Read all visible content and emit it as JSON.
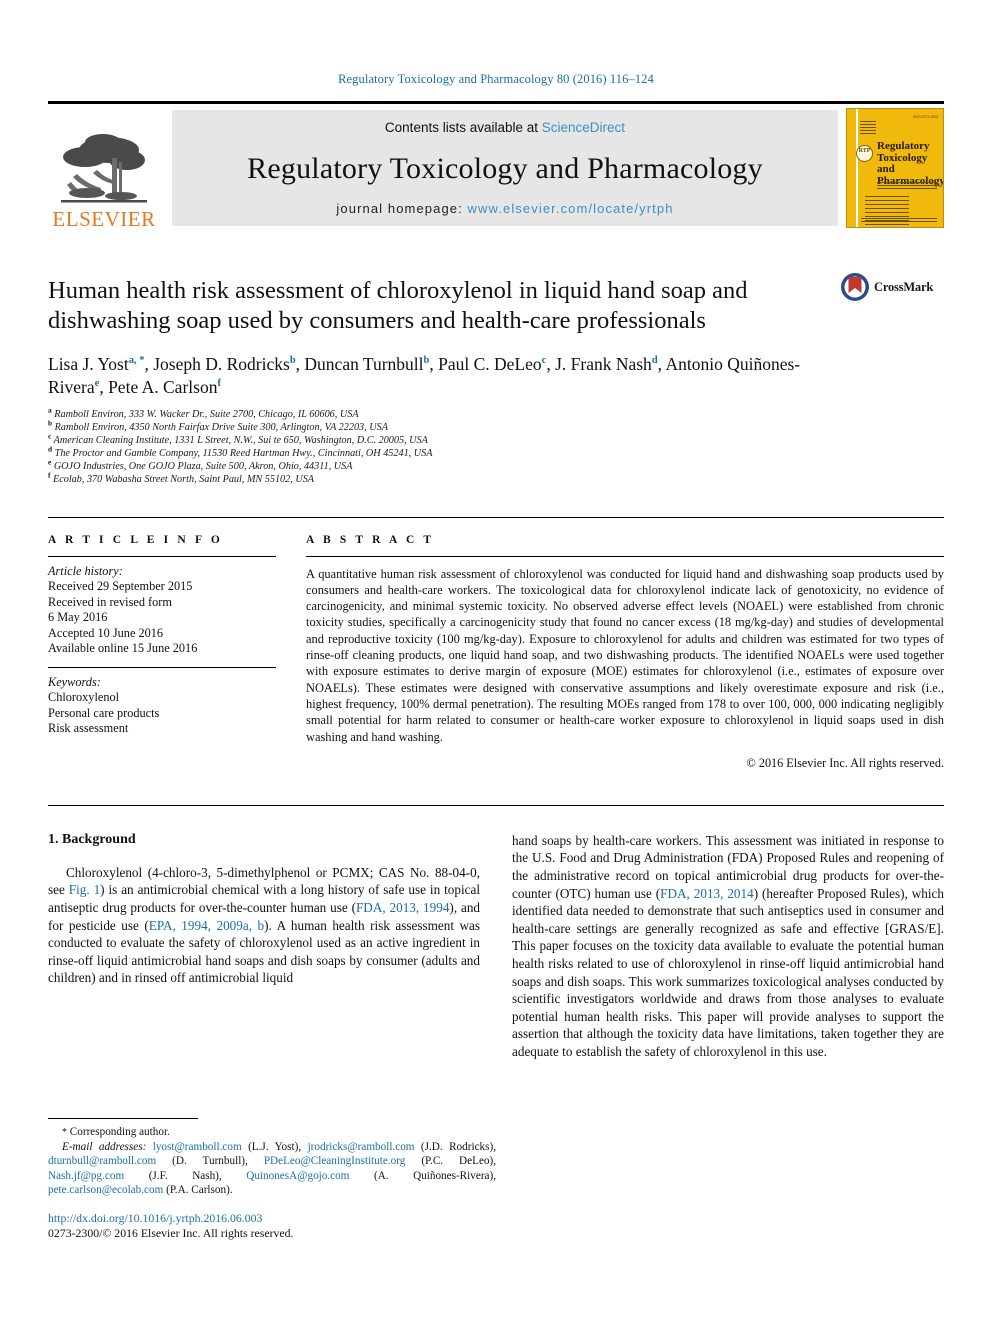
{
  "running_head": "Regulatory Toxicology and Pharmacology 80 (2016) 116–124",
  "colors": {
    "link_blue": "#1a6ea8",
    "sciencedirect_blue": "#3d8fc0",
    "elsevier_orange": "#E87722",
    "cover_yellow": "#f0b90b",
    "crossmark_blue": "#2a4b8d",
    "crossmark_red": "#c0392b"
  },
  "masthead": {
    "publisher_logo_name": "elsevier-tree-logo",
    "publisher_word": "ELSEVIER",
    "contents_prefix": "Contents lists available at",
    "contents_link": "ScienceDirect",
    "journal_title": "Regulatory Toxicology and Pharmacology",
    "homepage_label": "journal homepage:",
    "homepage_url": "www.elsevier.com/locate/yrtph",
    "cover": {
      "title": "Regulatory Toxicology and Pharmacology",
      "badge": "RTP"
    }
  },
  "article": {
    "title": "Human health risk assessment of chloroxylenol in liquid hand soap and dishwashing soap used by consumers and health-care professionals",
    "crossmark_label": "CrossMark",
    "authors": [
      {
        "name": "Lisa J. Yost",
        "marks": "a, *"
      },
      {
        "name": "Joseph D. Rodricks",
        "marks": "b"
      },
      {
        "name": "Duncan Turnbull",
        "marks": "b"
      },
      {
        "name": "Paul C. DeLeo",
        "marks": "c"
      },
      {
        "name": "J. Frank Nash",
        "marks": "d"
      },
      {
        "name": "Antonio Quiñones-Rivera",
        "marks": "e"
      },
      {
        "name": "Pete A. Carlson",
        "marks": "f"
      }
    ],
    "affiliations": [
      {
        "mark": "a",
        "text": "Ramboll Environ, 333 W. Wacker Dr., Suite 2700, Chicago, IL 60606, USA"
      },
      {
        "mark": "b",
        "text": "Ramboll Environ, 4350 North Fairfax Drive Suite 300, Arlington, VA 22203, USA"
      },
      {
        "mark": "c",
        "text": "American Cleaning Institute, 1331 L Street, N.W., Sui te 650, Washington, D.C. 20005, USA"
      },
      {
        "mark": "d",
        "text": "The Proctor and Gamble Company, 11530 Reed Hartman Hwy., Cincinnati, OH 45241, USA"
      },
      {
        "mark": "e",
        "text": "GOJO Industries, One GOJO Plaza, Suite 500, Akron, Ohio, 44311, USA"
      },
      {
        "mark": "f",
        "text": "Ecolab, 370 Wabasha Street North, Saint Paul, MN 55102, USA"
      }
    ]
  },
  "article_info": {
    "heading": "A R T I C L E   I N F O",
    "history_label": "Article history:",
    "history": [
      "Received 29 September 2015",
      "Received in revised form",
      "6 May 2016",
      "Accepted 10 June 2016",
      "Available online 15 June 2016"
    ],
    "keywords_label": "Keywords:",
    "keywords": [
      "Chloroxylenol",
      "Personal care products",
      "Risk assessment"
    ]
  },
  "abstract": {
    "heading": "A B S T R A C T",
    "body": "A quantitative human risk assessment of chloroxylenol was conducted for liquid hand and dishwashing soap products used by consumers and health-care workers. The toxicological data for chloroxylenol indicate lack of genotoxicity, no evidence of carcinogenicity, and minimal systemic toxicity. No observed adverse effect levels (NOAEL) were established from chronic toxicity studies, specifically a carcinogenicity study that found no cancer excess (18 mg/kg-day) and studies of developmental and reproductive toxicity (100 mg/kg-day). Exposure to chloroxylenol for adults and children was estimated for two types of rinse-off cleaning products, one liquid hand soap, and two dishwashing products. The identified NOAELs were used together with exposure estimates to derive margin of exposure (MOE) estimates for chloroxylenol (i.e., estimates of exposure over NOAELs). These estimates were designed with conservative assumptions and likely overestimate exposure and risk (i.e., highest frequency, 100% dermal penetration). The resulting MOEs ranged from 178 to over 100, 000, 000 indicating negligibly small potential for harm related to consumer or health-care worker exposure to chloroxylenol in liquid soaps used in dish washing and hand washing.",
    "copyright": "© 2016 Elsevier Inc. All rights reserved."
  },
  "body": {
    "section_heading": "1. Background",
    "left_para_1": "Chloroxylenol (4-chloro-3, 5-dimethylphenol or PCMX; CAS No. 88-04-0, see ",
    "left_link_fig": "Fig. 1",
    "left_para_2": ") is an antimicrobial chemical with a long history of safe use in topical antiseptic drug products for over-the-counter human use (",
    "left_link_fda": "FDA, 2013, 1994",
    "left_para_3": "), and for pesticide use (",
    "left_link_epa": "EPA, 1994, 2009a, b",
    "left_para_4": "). A human health risk assessment was conducted to evaluate the safety of chloroxylenol used as an active ingredient in rinse-off liquid antimicrobial hand soaps and dish soaps by consumer (adults and children) and in rinsed off antimicrobial liquid",
    "right_para_1": "hand soaps by health-care workers. This assessment was initiated in response to the U.S. Food and Drug Administration (FDA) Proposed Rules and reopening of the administrative record on topical antimicrobial drug products for over-the-counter (OTC) human use (",
    "right_link_fda": "FDA, 2013, 2014",
    "right_para_2": ") (hereafter Proposed Rules), which identified data needed to demonstrate that such antiseptics used in consumer and health-care settings are generally recognized as safe and effective [GRAS/E]. This paper focuses on the toxicity data available to evaluate the potential human health risks related to use of chloroxylenol in rinse-off liquid antimicrobial hand soaps and dish soaps. This work summarizes toxicological analyses conducted by scientific investigators worldwide and draws from those analyses to evaluate potential human health risks. This paper will provide analyses to support the assertion that although the toxicity data have limitations, taken together they are adequate to establish the safety of chloroxylenol in this use."
  },
  "footnote": {
    "corresponding": "Corresponding author.",
    "email_label": "E-mail addresses:",
    "emails": [
      {
        "address": "lyost@ramboll.com",
        "person": "(L.J. Yost)"
      },
      {
        "address": "jrodricks@ramboll.com",
        "person": "(J.D. Rodricks)"
      },
      {
        "address": "dturnbull@ramboll.com",
        "person": "(D. Turnbull)"
      },
      {
        "address": "PDeLeo@CleaningInstitute.org",
        "person": "(P.C. DeLeo)"
      },
      {
        "address": "Nash.jf@pg.com",
        "person": "(J.F. Nash)"
      },
      {
        "address": "QuinonesA@gojo.com",
        "person": "(A. Quiñones-Rivera)"
      },
      {
        "address": "pete.carlson@ecolab.com",
        "person": "(P.A. Carlson)"
      }
    ],
    "doi": "http://dx.doi.org/10.1016/j.yrtph.2016.06.003",
    "issn_line": "0273-2300/© 2016 Elsevier Inc. All rights reserved."
  }
}
